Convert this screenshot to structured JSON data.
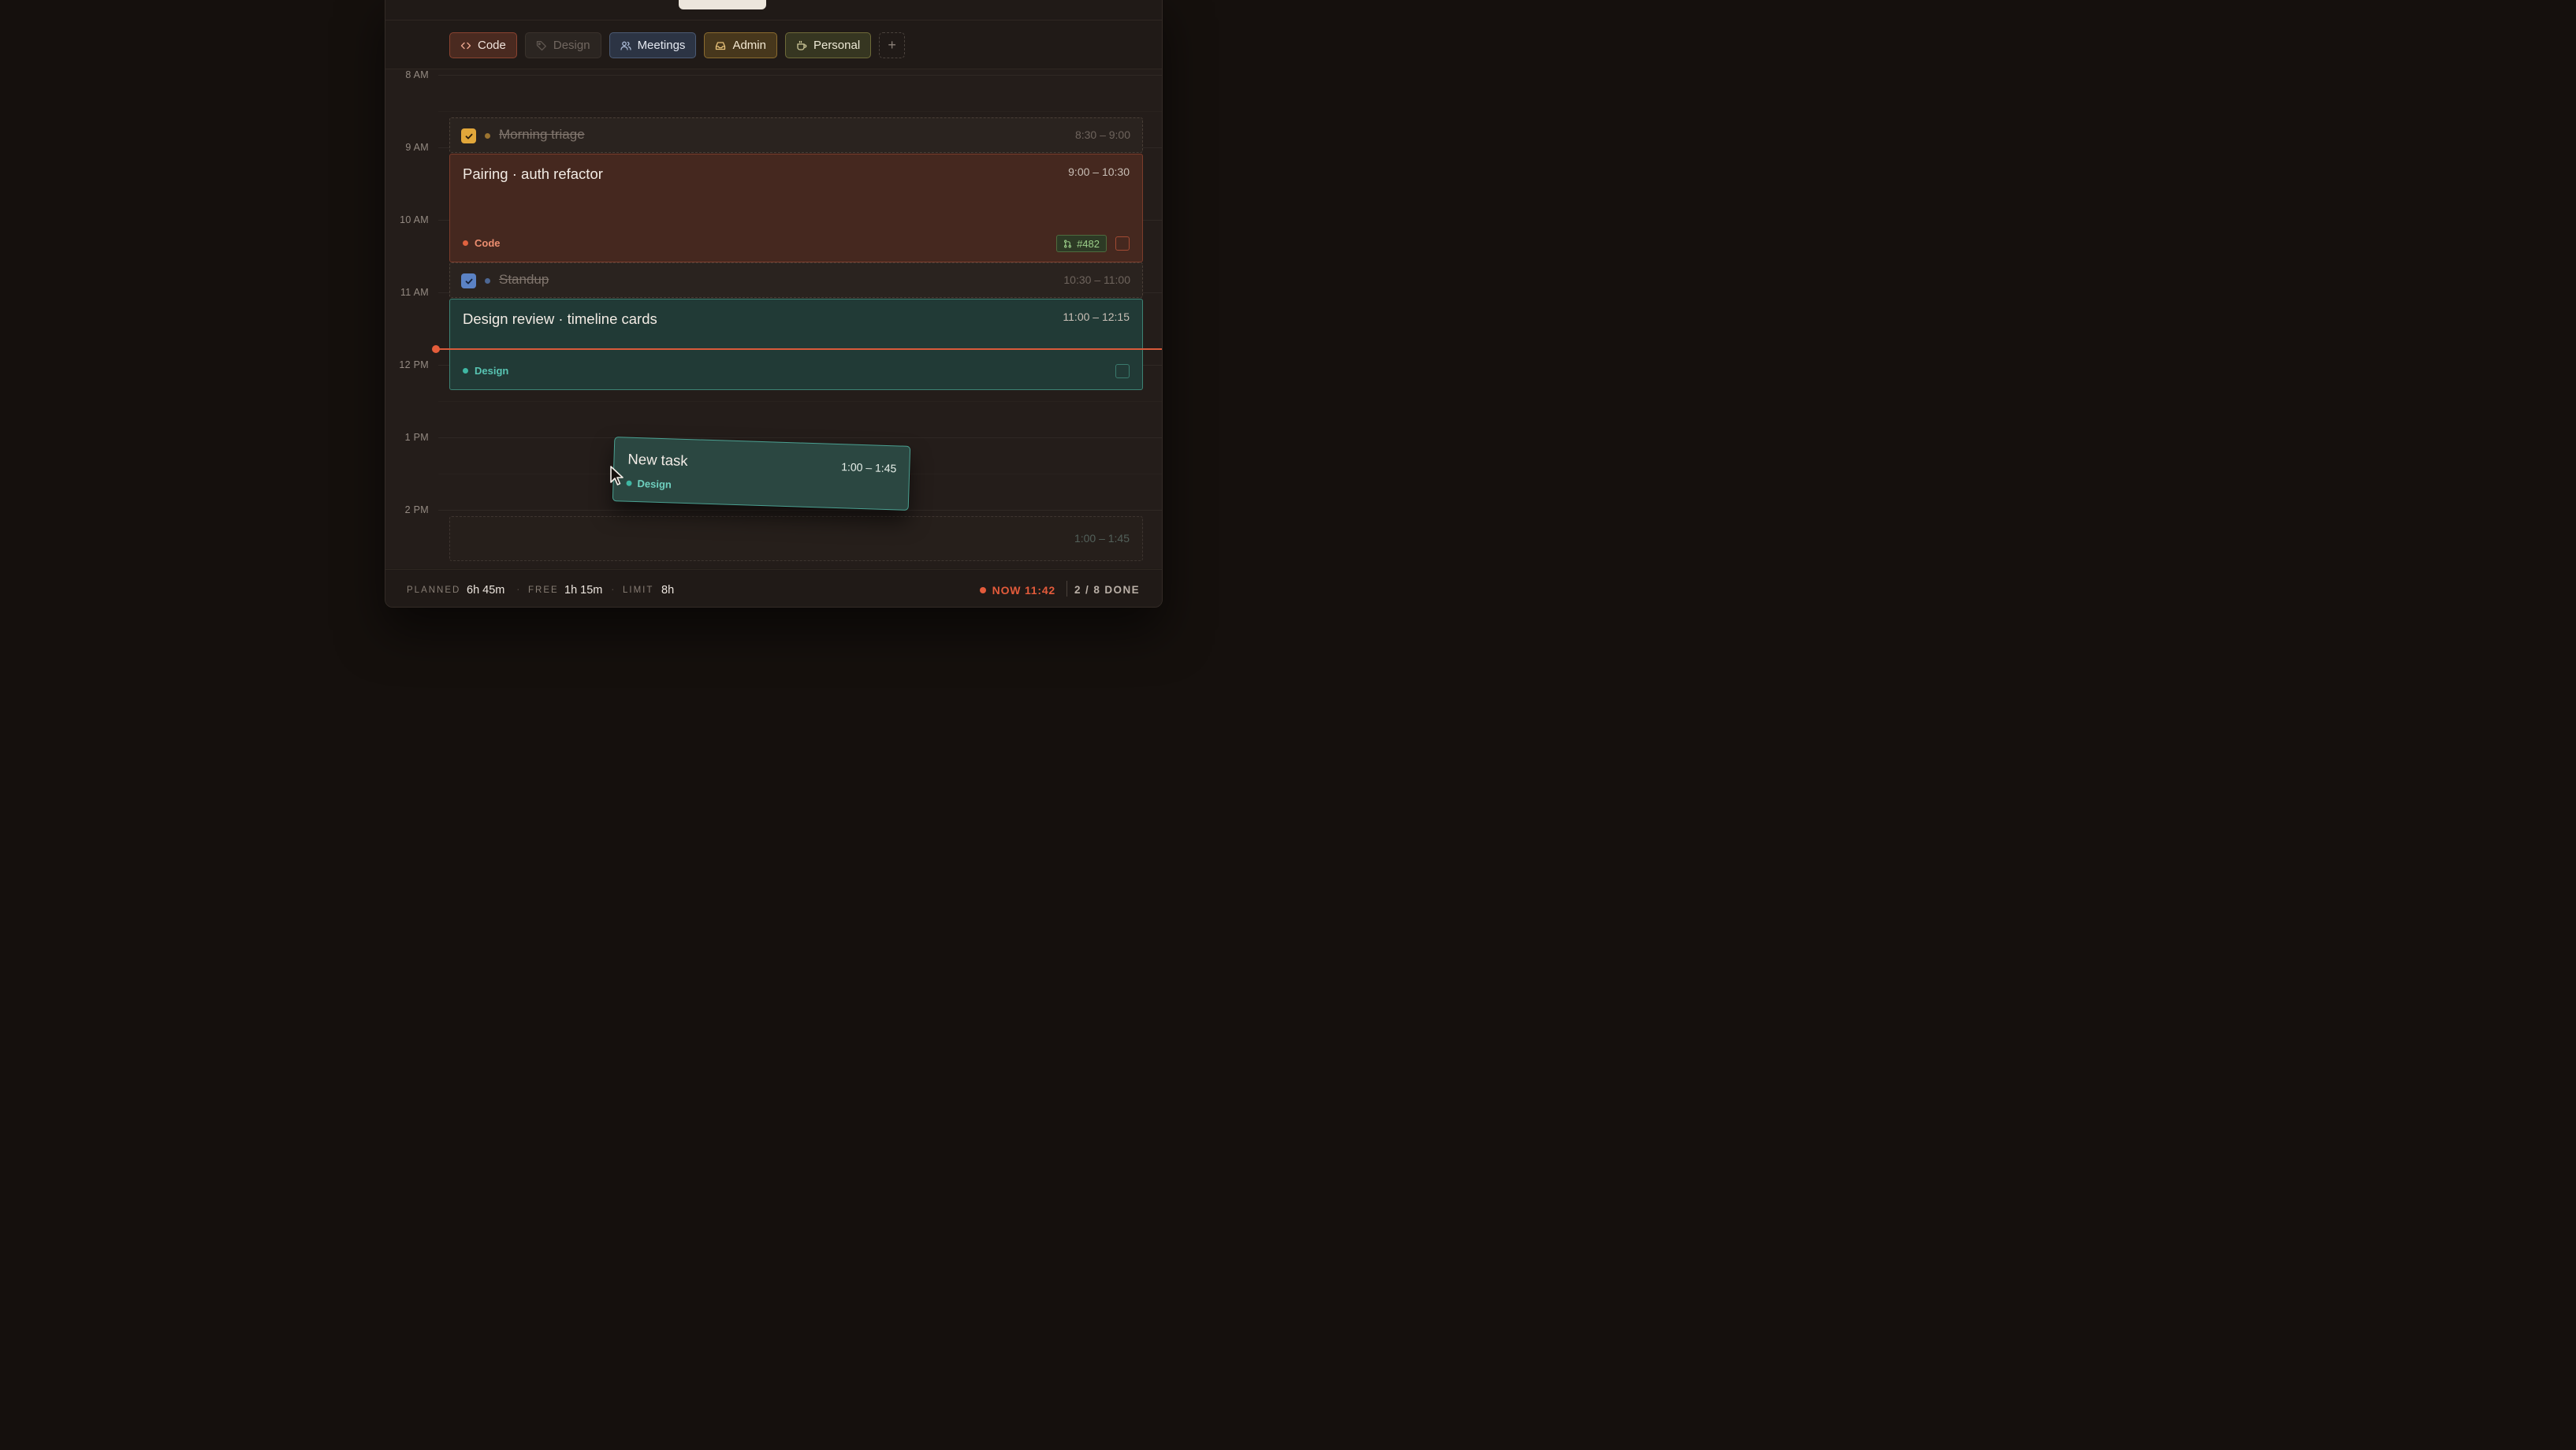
{
  "categories": [
    {
      "label": "Code",
      "icon": "code-icon"
    },
    {
      "label": "Design",
      "icon": "tag-icon"
    },
    {
      "label": "Meetings",
      "icon": "users-icon"
    },
    {
      "label": "Admin",
      "icon": "inbox-icon"
    },
    {
      "label": "Personal",
      "icon": "coffee-icon"
    }
  ],
  "add_label": "+",
  "hours": [
    "8 AM",
    "9 AM",
    "10 AM",
    "11 AM",
    "12 PM",
    "1 PM",
    "2 PM"
  ],
  "tasks": {
    "morning_triage": {
      "title": "Morning triage",
      "time": "8:30 – 9:00",
      "done": true
    },
    "pairing": {
      "title": "Pairing · auth refactor",
      "time": "9:00 – 10:30",
      "tag": "Code",
      "pr": "#482"
    },
    "standup": {
      "title": "Standup",
      "time": "10:30 – 11:00",
      "done": true
    },
    "design_review": {
      "title": "Design review · timeline cards",
      "time": "11:00 – 12:15",
      "tag": "Design"
    },
    "new_task": {
      "title": "New task",
      "time": "1:00 – 1:45",
      "tag": "Design"
    },
    "drop_target": {
      "time": "1:00 – 1:45"
    }
  },
  "footer": {
    "planned_label": "PLANNED",
    "planned_value": "6h 45m",
    "free_label": "FREE",
    "free_value": "1h 15m",
    "limit_label": "LIMIT",
    "limit_value": "8h",
    "separator": "·",
    "now": "NOW 11:42",
    "done": "2 / 8 DONE"
  },
  "colors": {
    "code": "#e0623f",
    "design": "#3fb7a3",
    "meetings": "#5b7fbf",
    "admin": "#e2a73a",
    "personal": "#a9a25a",
    "now": "#e35b3b"
  }
}
